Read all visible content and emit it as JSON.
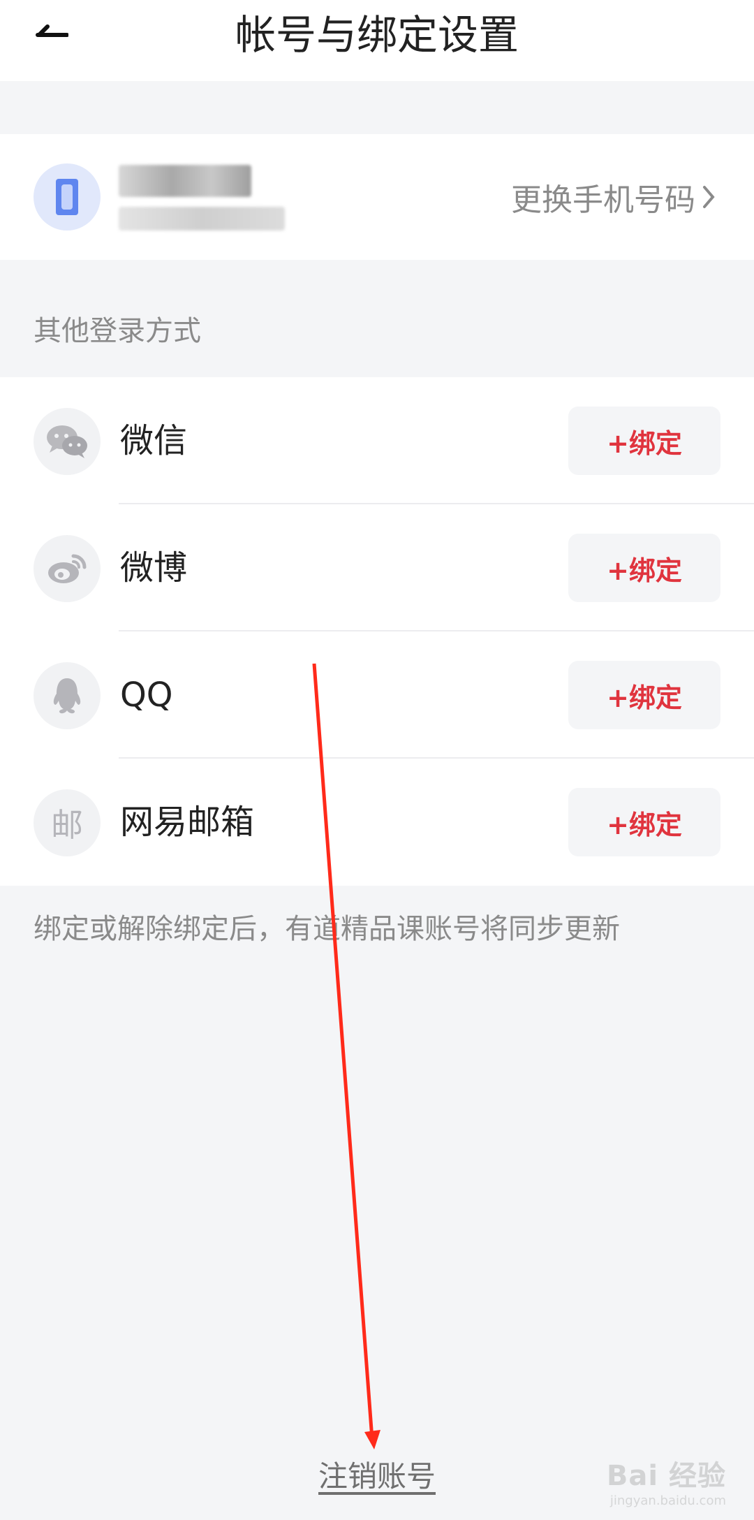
{
  "header": {
    "title": "帐号与绑定设置",
    "back_icon": "back-arrow-icon"
  },
  "account": {
    "change_phone_label": "更换手机号码",
    "avatar_color": "#5f86ef"
  },
  "other_login": {
    "section_label": "其他登录方式",
    "methods": [
      {
        "name": "微信",
        "icon": "wechat-icon",
        "bind_label": "+绑定"
      },
      {
        "name": "微博",
        "icon": "weibo-icon",
        "bind_label": "+绑定"
      },
      {
        "name": "QQ",
        "icon": "qq-icon",
        "bind_label": "+绑定"
      },
      {
        "name": "网易邮箱",
        "icon": "mail-icon",
        "bind_label": "+绑定",
        "icon_glyph": "邮"
      }
    ]
  },
  "note": "绑定或解除绑定后，有道精品课账号将同步更新",
  "cancel_account_label": "注销账号",
  "watermark": {
    "brand": "Bai 经验",
    "url": "jingyan.baidu.com"
  },
  "colors": {
    "accent_red": "#e0343e",
    "background": "#f4f5f7",
    "text_gray": "#8a8a8a"
  }
}
